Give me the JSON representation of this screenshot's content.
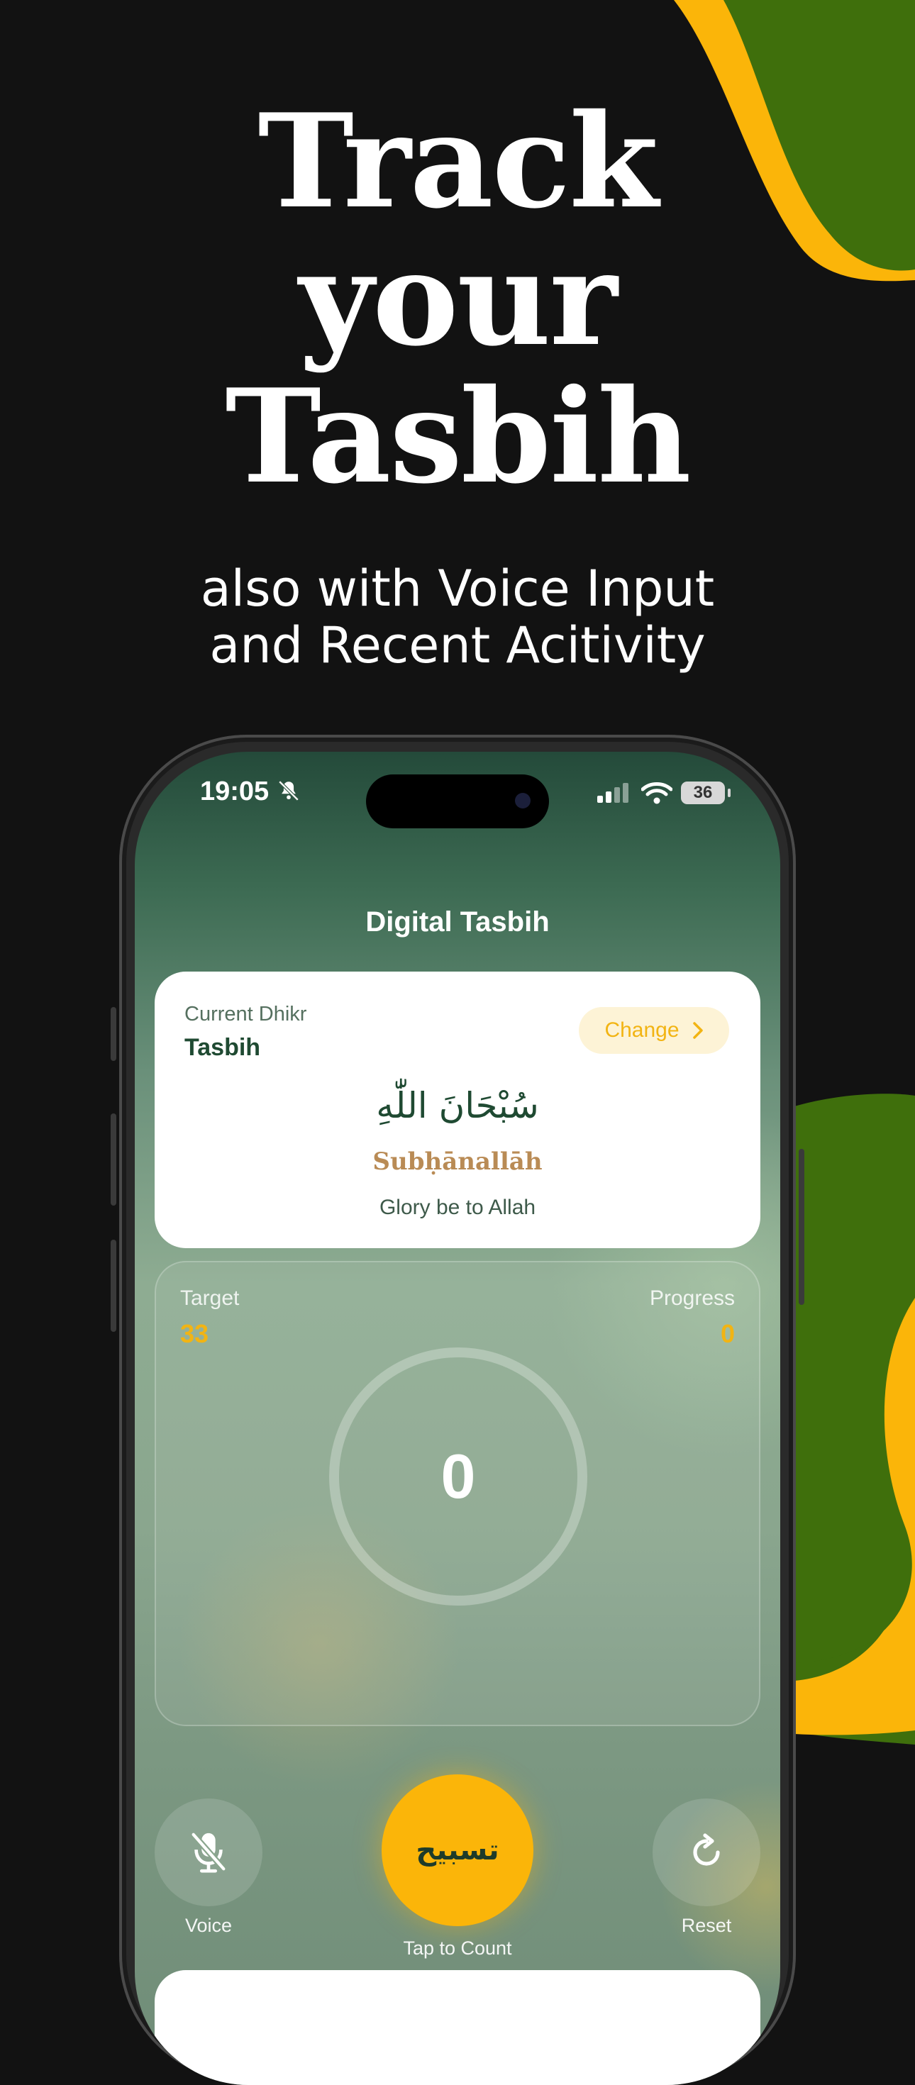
{
  "headline": {
    "line1": "Track",
    "line2": "your",
    "line3": "Tasbih"
  },
  "subline": {
    "line1": "also with Voice Input",
    "line2": "and Recent Acitivity"
  },
  "colors": {
    "background": "#121212",
    "accent_yellow": "#fbb509",
    "accent_green": "#3f6f0c",
    "text_green": "#1f4a32"
  },
  "status_bar": {
    "time": "19:05",
    "battery": "36",
    "icons": [
      "bell-slash-icon",
      "cellular-signal-icon",
      "wifi-icon",
      "battery-icon"
    ]
  },
  "screen": {
    "title": "Digital Tasbih"
  },
  "dhikr_card": {
    "label": "Current Dhikr",
    "name": "Tasbih",
    "change_label": "Change",
    "arabic": "سُبْحَانَ اللّٰهِ",
    "transliteration": "Subḥānallāh",
    "meaning": "Glory be to Allah"
  },
  "counter": {
    "target_label": "Target",
    "target": "33",
    "progress_label": "Progress",
    "progress": "0",
    "count": "0"
  },
  "actions": {
    "voice_label": "Voice",
    "tap_button": "تسبيح",
    "tap_label": "Tap to Count",
    "reset_label": "Reset"
  }
}
